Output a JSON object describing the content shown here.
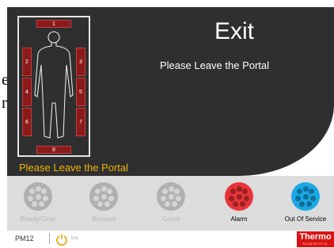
{
  "window": {
    "title": "Exit",
    "subtitle": "Please Leave the Portal"
  },
  "status_message": "Please Leave the Portal",
  "detectors": {
    "top": "1",
    "left_upper": "2",
    "right_upper": "3",
    "left_mid": "4",
    "right_mid": "5",
    "left_low": "6",
    "right_low": "7",
    "bottom": "8"
  },
  "stray_text": [
    "e",
    "r"
  ],
  "indicators": [
    {
      "label": "Ready/Clear",
      "state": "inactive",
      "color": "#b0b0b0",
      "label_color": "#b4b4b4"
    },
    {
      "label": "Recount",
      "state": "inactive",
      "color": "#b0b0b0",
      "label_color": "#b4b4b4"
    },
    {
      "label": "Count",
      "state": "inactive",
      "color": "#b0b0b0",
      "label_color": "#b4b4b4"
    },
    {
      "label": "Alarm",
      "state": "active",
      "color": "#e8343a",
      "label_color": "#000000"
    },
    {
      "label": "Out Of Service",
      "state": "active",
      "color": "#1ba9e6",
      "label_color": "#000000"
    }
  ],
  "status_bar": {
    "device": "PM12",
    "power_icon": "power-icon",
    "exit_label": "Exit"
  },
  "brand": {
    "name": "Thermo",
    "sub": "SCIENTIFIC",
    "color": "#dd1111"
  }
}
